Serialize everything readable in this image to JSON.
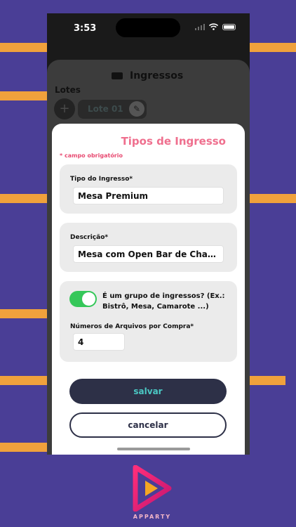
{
  "status_bar": {
    "time": "3:53"
  },
  "background_screen": {
    "title": "Ingressos",
    "lotes_label": "Lotes",
    "add_symbol": "+",
    "lote_chip": "Lote 01"
  },
  "modal": {
    "title": "Tipos de Ingresso",
    "required_note": "* campo obrigatório",
    "ticket_type": {
      "label": "Tipo do Ingresso*",
      "value": "Mesa Premium"
    },
    "description": {
      "label": "Descrição*",
      "value": "Mesa com Open Bar de Champagne"
    },
    "group_toggle": {
      "label": "É um grupo de ingressos? (Ex.: Bistrô, Mesa, Camarote ...)",
      "on": true
    },
    "files_per_purchase": {
      "label": "Números de Arquivos por Compra*",
      "value": "4"
    },
    "save_label": "salvar",
    "cancel_label": "cancelar"
  },
  "brand": {
    "name": "APPARTY"
  },
  "colors": {
    "background": "#4a3e96",
    "stripe": "#f0a13c",
    "accent_pink": "#ef6f8e",
    "save_button": "#2d3047",
    "save_text": "#4bc8c4",
    "toggle_on": "#35c759"
  }
}
